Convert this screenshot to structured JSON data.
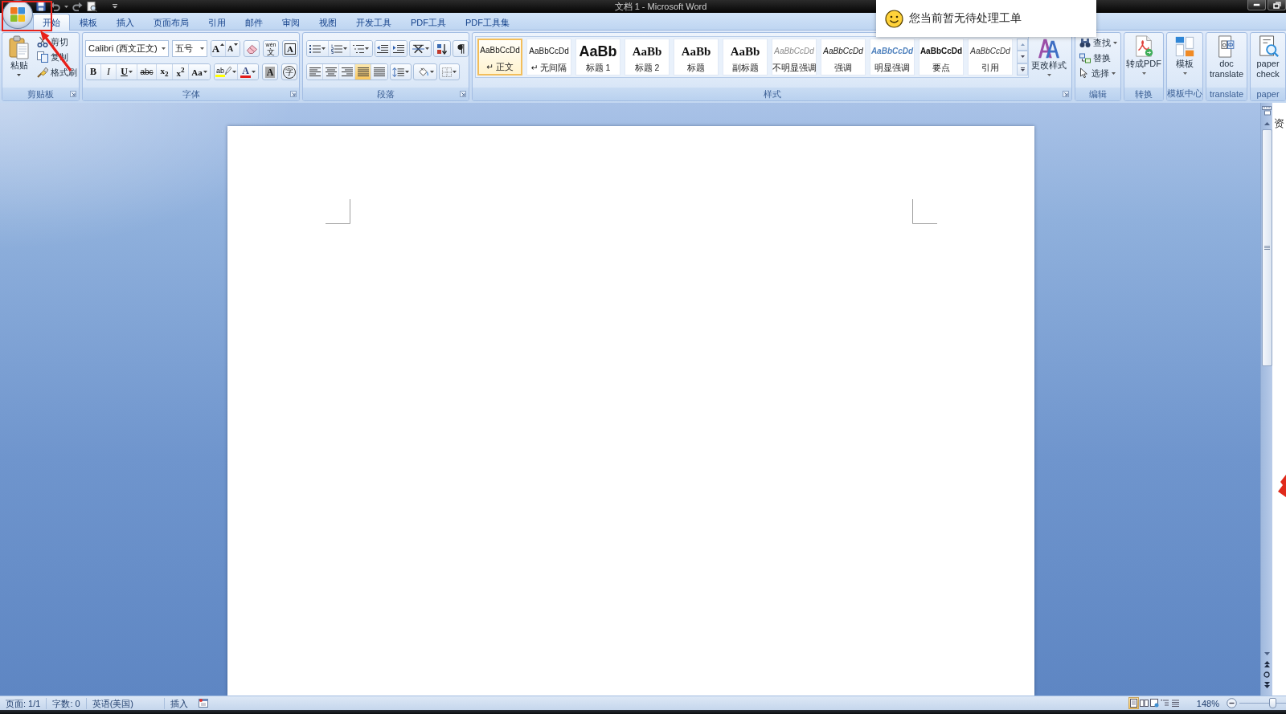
{
  "window": {
    "title": "文档 1 - Microsoft Word"
  },
  "notification": {
    "text": "您当前暂无待处理工单"
  },
  "tabs": [
    {
      "label": "开始",
      "selected": true
    },
    {
      "label": "模板",
      "selected": false
    },
    {
      "label": "插入",
      "selected": false
    },
    {
      "label": "页面布局",
      "selected": false
    },
    {
      "label": "引用",
      "selected": false
    },
    {
      "label": "邮件",
      "selected": false
    },
    {
      "label": "审阅",
      "selected": false
    },
    {
      "label": "视图",
      "selected": false
    },
    {
      "label": "开发工具",
      "selected": false
    },
    {
      "label": "PDF工具",
      "selected": false
    },
    {
      "label": "PDF工具集",
      "selected": false
    }
  ],
  "clipboard": {
    "label": "剪贴板",
    "paste": "粘贴",
    "cut": "剪切",
    "copy": "复制",
    "format_painter": "格式刷"
  },
  "font": {
    "label": "字体",
    "font_name": "Calibri (西文正文)",
    "font_size": "五号",
    "row_1": [
      [
        {
          "kind": "grow",
          "glyph": "A"
        },
        {
          "kind": "shrink",
          "glyph": "A"
        }
      ],
      [
        {
          "kind": "clear"
        }
      ],
      [
        {
          "kind": "phonetic",
          "glyph": "文",
          "ruby": "wén"
        }
      ],
      [
        {
          "kind": "border",
          "glyph": "A"
        }
      ]
    ],
    "row_2": [
      [
        {
          "kind": "bold",
          "glyph": "B"
        },
        {
          "kind": "italic",
          "glyph": "I"
        },
        {
          "kind": "underline",
          "glyph": "U"
        },
        {
          "kind": "strike",
          "glyph": "abc"
        },
        {
          "kind": "subscript",
          "glyph": "x$_{2}$"
        },
        {
          "kind": "superscript",
          "glyph": "x$^{2}$"
        },
        {
          "kind": "case",
          "glyph": "Aa"
        }
      ],
      [
        {
          "kind": "highlight",
          "glyph": "ab"
        },
        {
          "kind": "color",
          "glyph": "A"
        }
      ],
      [
        {
          "kind": "shading",
          "glyph": "A"
        }
      ],
      [
        {
          "kind": "enclosed",
          "glyph": "字"
        }
      ]
    ]
  },
  "paragraph": {
    "label": "段落",
    "alignment": [
      {
        "kind": "left",
        "selected": false
      },
      {
        "kind": "center",
        "selected": false
      },
      {
        "kind": "right",
        "selected": false
      },
      {
        "kind": "justify",
        "selected": true
      },
      {
        "kind": "distributed",
        "selected": false
      }
    ]
  },
  "styles": {
    "label": "样式",
    "gallery": [
      {
        "kind": "normal",
        "preview": "AaBbCcDd",
        "name": "↵ 正文",
        "selected": true
      },
      {
        "kind": "nospacing",
        "preview": "AaBbCcDd",
        "name": "↵ 无间隔",
        "selected": false
      },
      {
        "kind": "heading1",
        "preview": "AaBb",
        "name": "标题 1",
        "selected": false
      },
      {
        "kind": "heading2",
        "preview": "AaBb",
        "name": "标题 2",
        "selected": false
      },
      {
        "kind": "title",
        "preview": "AaBb",
        "name": "标题",
        "selected": false
      },
      {
        "kind": "subtitle",
        "preview": "AaBb",
        "name": "副标题",
        "selected": false
      },
      {
        "kind": "subtle",
        "preview": "AaBbCcDd",
        "name": "不明显强调",
        "selected": false
      },
      {
        "kind": "emphasis",
        "preview": "AaBbCcDd",
        "name": "强调",
        "selected": false
      },
      {
        "kind": "intense",
        "preview": "AaBbCcDd",
        "name": "明显强调",
        "selected": false
      },
      {
        "kind": "strong",
        "preview": "AaBbCcDd",
        "name": "要点",
        "selected": false
      },
      {
        "kind": "quote",
        "preview": "AaBbCcDd",
        "name": "引用",
        "selected": false
      }
    ],
    "change_styles": "更改样式"
  },
  "editing": {
    "label": "编辑",
    "find": "查找",
    "replace": "替换",
    "select": "选择"
  },
  "convert": {
    "label": "转换",
    "button": "转成PDF"
  },
  "templates": {
    "label": "模板中心",
    "button": "模板"
  },
  "translate": {
    "label": "translate",
    "button": "doc translate"
  },
  "paper": {
    "label": "paper",
    "button": "paper check"
  },
  "side_panel": {
    "text": "资"
  },
  "status_bar": {
    "page": "页面: 1/1",
    "words": "字数: 0",
    "language": "英语(美国)",
    "mode": "插入",
    "views": [
      {
        "kind": "print",
        "selected": true
      },
      {
        "kind": "reading",
        "selected": false
      },
      {
        "kind": "web",
        "selected": false
      },
      {
        "kind": "outline",
        "selected": false
      },
      {
        "kind": "draft",
        "selected": false
      }
    ],
    "zoom": "148%",
    "zoom_slider": {
      "level": 0.7
    }
  }
}
